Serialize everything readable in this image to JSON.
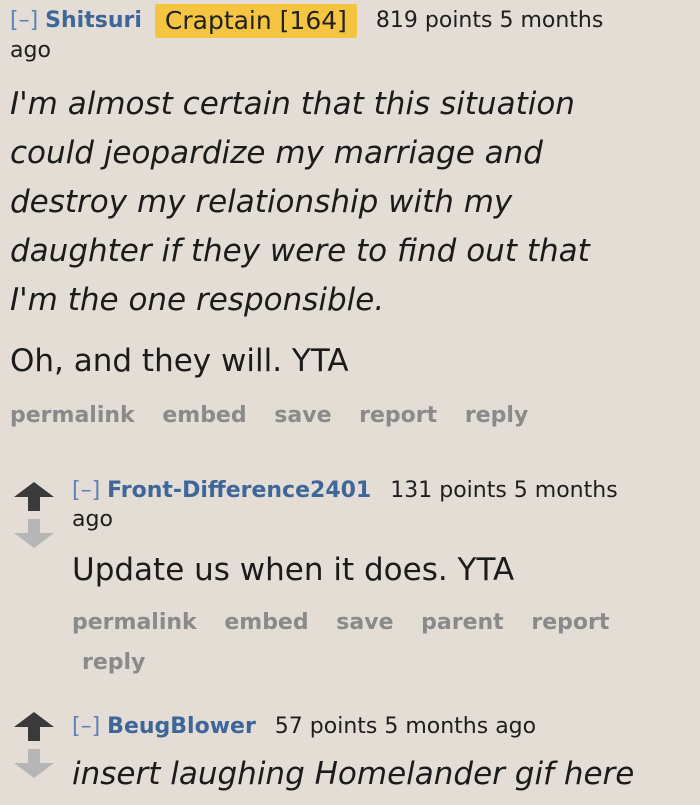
{
  "comments": [
    {
      "expand": "[–]",
      "author": "Shitsuri",
      "flair": "Craptain [164]",
      "score_line": "819 points 5 months",
      "score_line_cont": "ago",
      "body_italic": [
        "I'm almost certain that this situation",
        "could jeopardize my marriage and",
        "destroy my relationship with my",
        "daughter if they were to find out that",
        "I'm the one responsible."
      ],
      "body_plain": "Oh, and they will. YTA",
      "actions": [
        "permalink",
        "embed",
        "save",
        "report",
        "reply"
      ]
    },
    {
      "expand": "[–]",
      "author": "Front-Difference2401",
      "score_line": "131 points 5 months",
      "score_line_cont": "ago",
      "body_plain": "Update us when it does. YTA",
      "actions_line1": [
        "permalink",
        "embed",
        "save",
        "parent",
        "report"
      ],
      "actions_line2": [
        "reply"
      ]
    },
    {
      "expand": "[–]",
      "author": "BeugBlower",
      "score_line": "57 points 5 months ago",
      "body_italic": "insert laughing Homelander gif here"
    }
  ],
  "icons": {
    "upvote": "upvote-arrow-icon",
    "downvote": "downvote-arrow-icon"
  },
  "colors": {
    "background": "#e3ddd5",
    "author": "#3e6698",
    "flair_bg": "#f5c542",
    "actions": "#8a8a8a"
  }
}
